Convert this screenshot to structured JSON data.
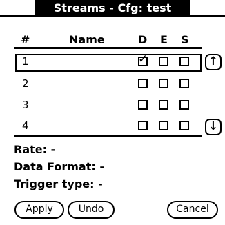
{
  "window": {
    "title": "Streams - Cfg: test"
  },
  "table": {
    "headers": {
      "number": "#",
      "name": "Name",
      "d": "D",
      "e": "E",
      "s": "S"
    },
    "rows": [
      {
        "number": "1",
        "name": "",
        "d": true,
        "e": false,
        "s": false,
        "selected": true
      },
      {
        "number": "2",
        "name": "",
        "d": false,
        "e": false,
        "s": false,
        "selected": false
      },
      {
        "number": "3",
        "name": "",
        "d": false,
        "e": false,
        "s": false,
        "selected": false
      },
      {
        "number": "4",
        "name": "",
        "d": false,
        "e": false,
        "s": false,
        "selected": false
      }
    ],
    "check_glyph": "✓",
    "scroll_up_glyph": "↑",
    "scroll_down_glyph": "↓"
  },
  "details": {
    "rate": "Rate: -",
    "data_format": "Data Format: -",
    "trigger_type": "Trigger type: -"
  },
  "buttons": {
    "apply": "Apply",
    "undo": "Undo",
    "cancel": "Cancel"
  }
}
